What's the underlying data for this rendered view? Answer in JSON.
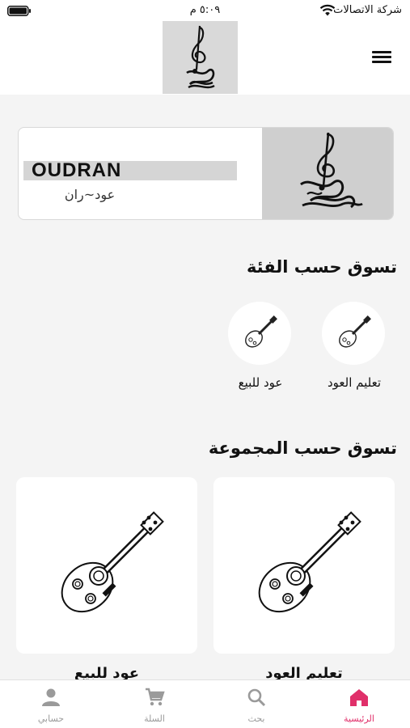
{
  "status_bar": {
    "carrier": "شركة الاتصالات",
    "time": "٥:٠٩ م"
  },
  "header": {
    "logo_icon": "treble-clef-calligraphy-logo",
    "menu_icon": "hamburger-menu-icon"
  },
  "banner": {
    "brand": "OUDRAN",
    "subtitle": "عود~ران"
  },
  "categories_section": {
    "title": "تسوق حسب الفئة",
    "items": [
      {
        "label": "تعليم العود",
        "icon": "oud-icon"
      },
      {
        "label": "عود للبيع",
        "icon": "oud-icon"
      }
    ]
  },
  "collections_section": {
    "title": "تسوق حسب المجموعة",
    "items": [
      {
        "label": "تعليم العود",
        "icon": "oud-illustration"
      },
      {
        "label": "عود للبيع",
        "icon": "oud-illustration"
      }
    ]
  },
  "tab_bar": {
    "items": [
      {
        "label": "الرئيسية",
        "icon": "home-icon",
        "active": true
      },
      {
        "label": "بحث",
        "icon": "search-icon",
        "active": false
      },
      {
        "label": "السلة",
        "icon": "cart-icon",
        "active": false
      },
      {
        "label": "حسابي",
        "icon": "person-icon",
        "active": false
      }
    ]
  },
  "colors": {
    "accent": "#e0306a",
    "background": "#f4f4f4",
    "card": "#ffffff",
    "inactive_tab": "#9a9a9a"
  }
}
